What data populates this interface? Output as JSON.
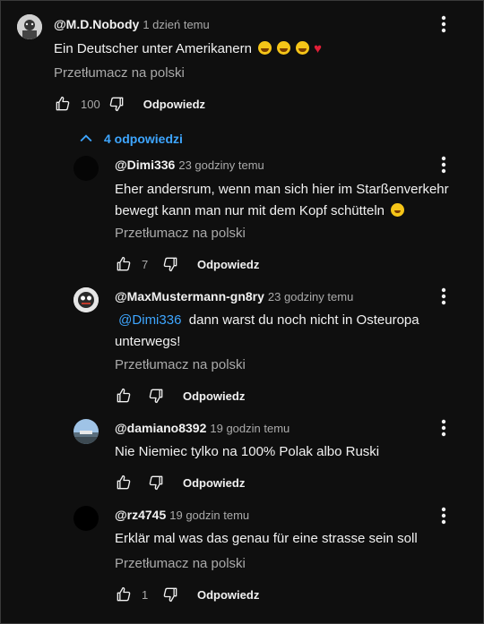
{
  "comments": [
    {
      "author": "@M.D.Nobody",
      "time": "1 dzień temu",
      "text": "Ein Deutscher unter Amerikanern",
      "emojis": [
        "laugh-cry",
        "laugh-cry",
        "laugh-cry",
        "red-heart"
      ],
      "translate": "Przetłumacz na polski",
      "likes": "100",
      "reply": "Odpowiedz"
    },
    {
      "author": "@Dimi336",
      "time": "23 godziny temu",
      "text_line1": "Eher andersrum, wenn man sich hier im Starßenverkehr",
      "text_line2": "bewegt kann man nur mit dem Kopf schütteln",
      "emojis": [
        "sweat-smile"
      ],
      "translate": "Przetłumacz na polski",
      "likes": "7",
      "reply": "Odpowiedz"
    },
    {
      "author": "@MaxMustermann-gn8ry",
      "time": "23 godziny temu",
      "mention": "@Dimi336",
      "text_line1": "dann warst du noch nicht in Osteuropa",
      "text_line2": "unterwegs!",
      "translate": "Przetłumacz na polski",
      "reply": "Odpowiedz"
    },
    {
      "author": "@damiano8392",
      "time": "19 godzin temu",
      "text": "Nie Niemiec tylko na 100% Polak albo Ruski",
      "reply": "Odpowiedz"
    },
    {
      "author": "@rz4745",
      "time": "19 godzin temu",
      "text": "Erklär mal was das genau für eine strasse sein soll",
      "translate": "Przetłumacz na polski",
      "likes": "1",
      "reply": "Odpowiedz"
    }
  ],
  "replies_toggle": "4 odpowiedzi",
  "colors": {
    "background": "#0f0f0f",
    "link": "#3ea6ff",
    "muted": "#aaaaaa"
  },
  "icons": [
    "thumb-up-icon",
    "thumb-down-icon",
    "more-vert-icon",
    "chevron-up-icon"
  ]
}
